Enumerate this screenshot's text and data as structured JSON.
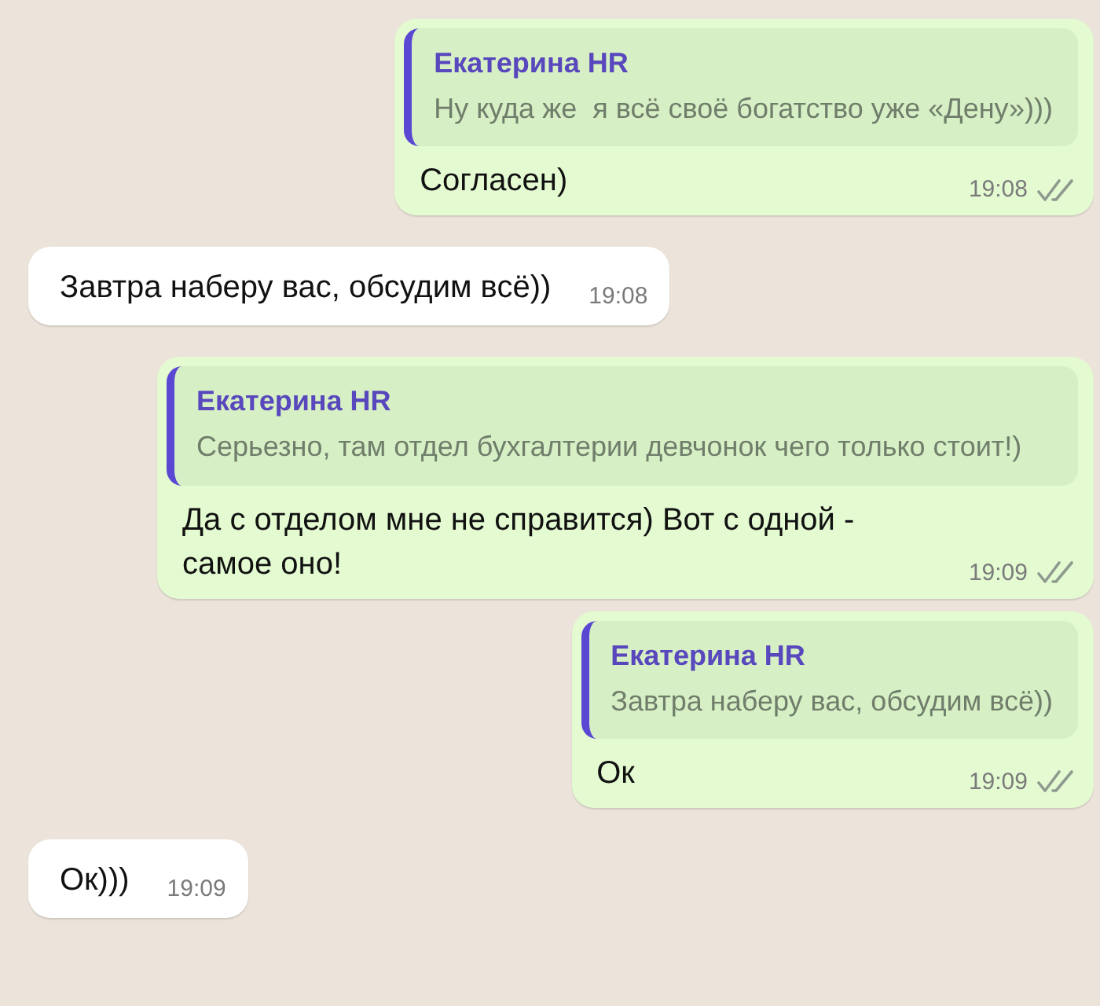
{
  "messages": [
    {
      "kind": "outgoing",
      "reply": {
        "author": "Екатерина HR",
        "text": "Ну куда же  я всё своё богатство уже «Дену»)))"
      },
      "text": "Согласен)",
      "time": "19:08",
      "read": false
    },
    {
      "kind": "incoming",
      "text": "Завтра наберу вас, обсудим всё))",
      "time": "19:08"
    },
    {
      "kind": "outgoing",
      "reply": {
        "author": "Екатерина HR",
        "text": "Серьезно, там отдел бухгалтерии девчонок чего только стоит!)"
      },
      "text": "Да с отделом мне не справится) Вот с одной - самое оно!",
      "time": "19:09",
      "read": false
    },
    {
      "kind": "outgoing",
      "reply": {
        "author": "Екатерина HR",
        "text": "Завтра наберу вас, обсудим всё))"
      },
      "text": "Ок",
      "time": "19:09",
      "read": false
    },
    {
      "kind": "incoming",
      "text": "Ок)))",
      "time": "19:09"
    }
  ]
}
